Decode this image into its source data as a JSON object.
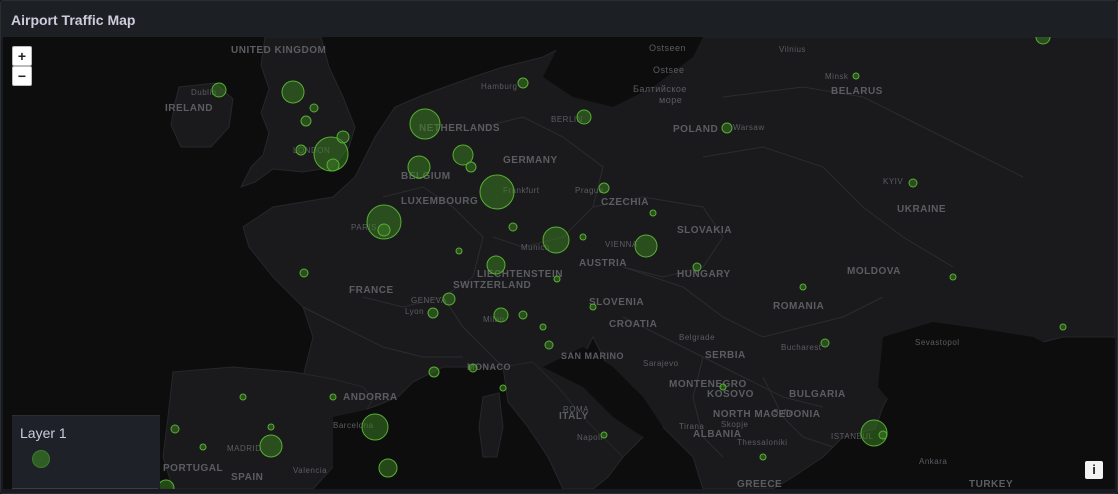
{
  "panel": {
    "title": "Airport Traffic Map"
  },
  "zoom": {
    "in_label": "+",
    "out_label": "−"
  },
  "legend": {
    "title": "Layer 1",
    "color": "#2f5e24"
  },
  "info": {
    "label": "i"
  },
  "map": {
    "land_color": "#1a1a1c",
    "sea_color": "#0d0d0e",
    "marker_fill": "#3a7a23",
    "marker_stroke": "#56b032",
    "country_labels": [
      "UNITED KINGDOM",
      "IRELAND",
      "NETHERLANDS",
      "BELGIUM",
      "LUXEMBOURG",
      "GERMANY",
      "FRANCE",
      "SWITZERLAND",
      "LIECHTENSTEIN",
      "AUSTRIA",
      "CZECHIA",
      "SLOVAKIA",
      "HUNGARY",
      "POLAND",
      "BELARUS",
      "UKRAINE",
      "MOLDOVA",
      "ROMANIA",
      "SLOVENIA",
      "CROATIA",
      "SERBIA",
      "MONTENEGRO",
      "KOSOVO",
      "NORTH MACEDONIA",
      "ALBANIA",
      "BULGARIA",
      "GREECE",
      "TURKEY",
      "ITALY",
      "SAN MARINO",
      "MONACO",
      "ANDORRA",
      "SPAIN",
      "PORTUGAL"
    ],
    "city_labels": [
      "Dublin",
      "LONDON",
      "PARIS",
      "BERLIN",
      "Hamburg",
      "Frankfurt",
      "Prague",
      "Munich",
      "VIENNA",
      "Warsaw",
      "Minsk",
      "Vilnius",
      "KYIV",
      "Lyon",
      "GENEVA",
      "Milan",
      "Belgrade",
      "Bucharest",
      "Sarajevo",
      "Barcelona",
      "MADRID",
      "Valencia",
      "ROMA",
      "Napoli",
      "Sofia",
      "Thessaloniki",
      "Skopje",
      "ISTANBUL",
      "Ankara",
      "Sevastopol",
      "Tirana"
    ],
    "sea_labels": [
      "Ostseen",
      "Ostsee",
      "Балтийское",
      "море"
    ]
  }
}
